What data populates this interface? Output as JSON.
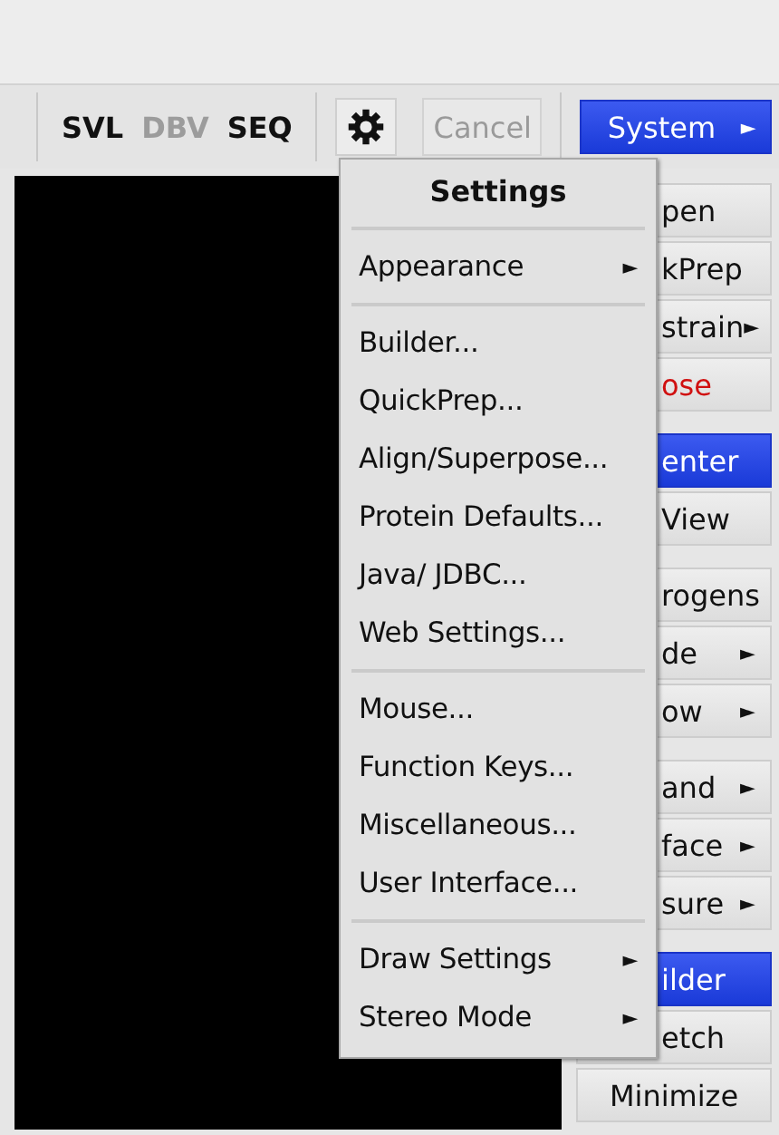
{
  "toolbar": {
    "view_buttons": [
      {
        "label": "SVL",
        "disabled": false
      },
      {
        "label": "DBV",
        "disabled": true
      },
      {
        "label": "SEQ",
        "disabled": false
      }
    ],
    "cancel": {
      "label": "Cancel",
      "disabled": true
    },
    "system": {
      "label": "System",
      "selected": true,
      "arrow": "►"
    }
  },
  "side_panel": {
    "groups": [
      [
        {
          "label": "pen",
          "selected": false
        },
        {
          "label": "kPrep",
          "selected": false
        },
        {
          "label": "strain",
          "selected": false,
          "arrow": "►"
        },
        {
          "label": "ose",
          "selected": false,
          "color": "#d01010"
        }
      ],
      [
        {
          "label": "enter",
          "selected": true
        },
        {
          "label": "View",
          "selected": false
        }
      ],
      [
        {
          "label": "rogens",
          "selected": false
        },
        {
          "label": "de",
          "selected": false,
          "arrow": "►"
        },
        {
          "label": "ow",
          "selected": false,
          "arrow": "►"
        }
      ],
      [
        {
          "label": "and",
          "selected": false,
          "arrow": "►"
        },
        {
          "label": "face",
          "selected": false,
          "arrow": "►"
        },
        {
          "label": "sure",
          "selected": false,
          "arrow": "►"
        }
      ],
      [
        {
          "label": "ilder",
          "selected": true
        },
        {
          "label": "etch",
          "selected": false
        },
        {
          "label": "Minimize",
          "selected": false,
          "full": true
        }
      ]
    ]
  },
  "settings_menu": {
    "title": "Settings",
    "groups": [
      [
        {
          "label": "Appearance",
          "arrow": "►"
        }
      ],
      [
        {
          "label": "Builder..."
        },
        {
          "label": "QuickPrep..."
        },
        {
          "label": "Align/Superpose..."
        },
        {
          "label": "Protein Defaults..."
        },
        {
          "label": "Java/ JDBC..."
        },
        {
          "label": "Web Settings..."
        }
      ],
      [
        {
          "label": "Mouse..."
        },
        {
          "label": "Function Keys..."
        },
        {
          "label": "Miscellaneous..."
        },
        {
          "label": "User Interface..."
        }
      ],
      [
        {
          "label": "Draw Settings",
          "arrow": "►"
        },
        {
          "label": "Stereo Mode",
          "arrow": "►"
        }
      ]
    ]
  }
}
